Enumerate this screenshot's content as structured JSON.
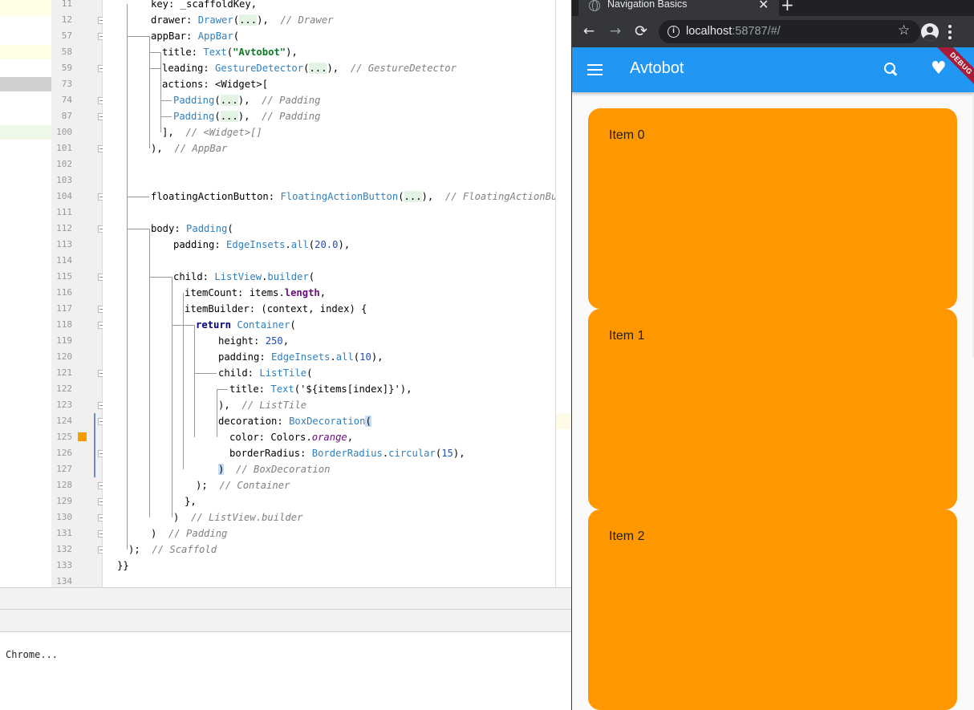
{
  "ide": {
    "lines": [
      {
        "no": "11",
        "tokens": [
          {
            "t": "key: _scaffoldKey,",
            "c": "tk-prop"
          }
        ]
      },
      {
        "no": "12",
        "tokens": [
          {
            "t": "drawer: ",
            "c": "tk-prop"
          },
          {
            "t": "Drawer",
            "c": "tk-cls"
          },
          {
            "t": "(",
            "c": "tk-prop"
          },
          {
            "t": "...",
            "c": "tk-ell"
          },
          {
            "t": "),  ",
            "c": "tk-prop"
          },
          {
            "t": "// Drawer",
            "c": "tk-cmt"
          }
        ]
      },
      {
        "no": "57",
        "tokens": [
          {
            "t": "appBar: ",
            "c": "tk-prop"
          },
          {
            "t": "AppBar",
            "c": "tk-cls"
          },
          {
            "t": "(",
            "c": "tk-prop"
          }
        ]
      },
      {
        "no": "58",
        "tokens": [
          {
            "t": "title: ",
            "c": "tk-prop"
          },
          {
            "t": "Text",
            "c": "tk-cls"
          },
          {
            "t": "(",
            "c": "tk-prop"
          },
          {
            "t": "\"Avtobot\"",
            "c": "tk-str"
          },
          {
            "t": "),",
            "c": "tk-prop"
          }
        ]
      },
      {
        "no": "59",
        "tokens": [
          {
            "t": "leading: ",
            "c": "tk-prop"
          },
          {
            "t": "GestureDetector",
            "c": "tk-cls"
          },
          {
            "t": "(",
            "c": "tk-prop"
          },
          {
            "t": "...",
            "c": "tk-ell"
          },
          {
            "t": "),  ",
            "c": "tk-prop"
          },
          {
            "t": "// GestureDetector",
            "c": "tk-cmt"
          }
        ]
      },
      {
        "no": "73",
        "tokens": [
          {
            "t": "actions: <Widget>[",
            "c": "tk-prop"
          }
        ]
      },
      {
        "no": "74",
        "tokens": [
          {
            "t": "Padding",
            "c": "tk-cls"
          },
          {
            "t": "(",
            "c": "tk-prop"
          },
          {
            "t": "...",
            "c": "tk-ell"
          },
          {
            "t": "),  ",
            "c": "tk-prop"
          },
          {
            "t": "// Padding",
            "c": "tk-cmt"
          }
        ]
      },
      {
        "no": "87",
        "tokens": [
          {
            "t": "Padding",
            "c": "tk-cls"
          },
          {
            "t": "(",
            "c": "tk-prop"
          },
          {
            "t": "...",
            "c": "tk-ell"
          },
          {
            "t": "),  ",
            "c": "tk-prop"
          },
          {
            "t": "// Padding",
            "c": "tk-cmt"
          }
        ]
      },
      {
        "no": "100",
        "tokens": [
          {
            "t": "],  ",
            "c": "tk-prop"
          },
          {
            "t": "// <Widget>[]",
            "c": "tk-cmt"
          }
        ]
      },
      {
        "no": "101",
        "tokens": [
          {
            "t": "),  ",
            "c": "tk-prop"
          },
          {
            "t": "// AppBar",
            "c": "tk-cmt"
          }
        ]
      },
      {
        "no": "102",
        "tokens": []
      },
      {
        "no": "103",
        "tokens": []
      },
      {
        "no": "104",
        "tokens": [
          {
            "t": "floatingActionButton: ",
            "c": "tk-prop"
          },
          {
            "t": "FloatingActionButton",
            "c": "tk-cls"
          },
          {
            "t": "(",
            "c": "tk-prop"
          },
          {
            "t": "...",
            "c": "tk-ell"
          },
          {
            "t": "),  ",
            "c": "tk-prop"
          },
          {
            "t": "// FloatingActionButton",
            "c": "tk-cmt"
          }
        ]
      },
      {
        "no": "111",
        "tokens": []
      },
      {
        "no": "112",
        "tokens": [
          {
            "t": "body: ",
            "c": "tk-prop"
          },
          {
            "t": "Padding",
            "c": "tk-cls"
          },
          {
            "t": "(",
            "c": "tk-prop"
          }
        ]
      },
      {
        "no": "113",
        "tokens": [
          {
            "t": "padding: ",
            "c": "tk-prop"
          },
          {
            "t": "EdgeInsets",
            "c": "tk-cls"
          },
          {
            "t": ".",
            "c": "tk-prop"
          },
          {
            "t": "all",
            "c": "tk-cls"
          },
          {
            "t": "(",
            "c": "tk-prop"
          },
          {
            "t": "20.0",
            "c": "tk-num"
          },
          {
            "t": "),",
            "c": "tk-prop"
          }
        ]
      },
      {
        "no": "114",
        "tokens": []
      },
      {
        "no": "115",
        "tokens": [
          {
            "t": "child: ",
            "c": "tk-prop"
          },
          {
            "t": "ListView",
            "c": "tk-cls"
          },
          {
            "t": ".",
            "c": "tk-prop"
          },
          {
            "t": "builder",
            "c": "tk-cls"
          },
          {
            "t": "(",
            "c": "tk-prop"
          }
        ]
      },
      {
        "no": "116",
        "tokens": [
          {
            "t": "itemCount: items.",
            "c": "tk-prop"
          },
          {
            "t": "length",
            "c": "tk-field"
          },
          {
            "t": ",",
            "c": "tk-prop"
          }
        ]
      },
      {
        "no": "117",
        "tokens": [
          {
            "t": "itemBuilder: (context, index) {",
            "c": "tk-prop"
          }
        ]
      },
      {
        "no": "118",
        "tokens": [
          {
            "t": "return ",
            "c": "tk-kw"
          },
          {
            "t": "Container",
            "c": "tk-cls"
          },
          {
            "t": "(",
            "c": "tk-prop"
          }
        ]
      },
      {
        "no": "119",
        "tokens": [
          {
            "t": "height: ",
            "c": "tk-prop"
          },
          {
            "t": "250",
            "c": "tk-num"
          },
          {
            "t": ",",
            "c": "tk-prop"
          }
        ]
      },
      {
        "no": "120",
        "tokens": [
          {
            "t": "padding: ",
            "c": "tk-prop"
          },
          {
            "t": "EdgeInsets",
            "c": "tk-cls"
          },
          {
            "t": ".",
            "c": "tk-prop"
          },
          {
            "t": "all",
            "c": "tk-cls"
          },
          {
            "t": "(",
            "c": "tk-prop"
          },
          {
            "t": "10",
            "c": "tk-num"
          },
          {
            "t": "),",
            "c": "tk-prop"
          }
        ]
      },
      {
        "no": "121",
        "tokens": [
          {
            "t": "child: ",
            "c": "tk-prop"
          },
          {
            "t": "ListTile",
            "c": "tk-cls"
          },
          {
            "t": "(",
            "c": "tk-prop"
          }
        ]
      },
      {
        "no": "122",
        "tokens": [
          {
            "t": "title: ",
            "c": "tk-prop"
          },
          {
            "t": "Text",
            "c": "tk-cls"
          },
          {
            "t": "('${items[index]}'),",
            "c": "tk-prop"
          }
        ]
      },
      {
        "no": "123",
        "tokens": [
          {
            "t": "),  ",
            "c": "tk-prop"
          },
          {
            "t": "// ListTile",
            "c": "tk-cmt"
          }
        ]
      },
      {
        "no": "124",
        "tokens": [
          {
            "t": "decoration: ",
            "c": "tk-prop"
          },
          {
            "t": "BoxDecoration",
            "c": "tk-cls"
          },
          {
            "t": "(",
            "c": "tk-brace"
          }
        ]
      },
      {
        "no": "125",
        "tokens": [
          {
            "t": "color: Colors.",
            "c": "tk-prop"
          },
          {
            "t": "orange",
            "c": "tk-cst"
          },
          {
            "t": ",",
            "c": "tk-prop"
          }
        ]
      },
      {
        "no": "126",
        "tokens": [
          {
            "t": "borderRadius: ",
            "c": "tk-prop"
          },
          {
            "t": "BorderRadius",
            "c": "tk-cls"
          },
          {
            "t": ".",
            "c": "tk-prop"
          },
          {
            "t": "circular",
            "c": "tk-cls"
          },
          {
            "t": "(",
            "c": "tk-prop"
          },
          {
            "t": "15",
            "c": "tk-num"
          },
          {
            "t": "),",
            "c": "tk-prop"
          }
        ]
      },
      {
        "no": "127",
        "tokens": [
          {
            "t": ")",
            "c": "tk-brace"
          },
          {
            "t": "  ",
            "c": "tk-prop"
          },
          {
            "t": "// BoxDecoration",
            "c": "tk-cmt"
          }
        ]
      },
      {
        "no": "128",
        "tokens": [
          {
            "t": ");  ",
            "c": "tk-prop"
          },
          {
            "t": "// Container",
            "c": "tk-cmt"
          }
        ]
      },
      {
        "no": "129",
        "tokens": [
          {
            "t": "},",
            "c": "tk-prop"
          }
        ]
      },
      {
        "no": "130",
        "tokens": [
          {
            "t": ")  ",
            "c": "tk-prop"
          },
          {
            "t": "// ListView.builder",
            "c": "tk-cmt"
          }
        ]
      },
      {
        "no": "131",
        "tokens": [
          {
            "t": ")  ",
            "c": "tk-prop"
          },
          {
            "t": "// Padding",
            "c": "tk-cmt"
          }
        ]
      },
      {
        "no": "132",
        "tokens": [
          {
            "t": ");  ",
            "c": "tk-prop"
          },
          {
            "t": "// Scaffold",
            "c": "tk-cmt"
          }
        ]
      },
      {
        "no": "133",
        "tokens": [
          {
            "t": "}}",
            "c": "tk-prop"
          }
        ]
      },
      {
        "no": "134",
        "tokens": []
      }
    ],
    "console_text": "Chrome..."
  },
  "browser": {
    "tab_title": "Navigation Basics",
    "tab_close": "✕",
    "new_tab": "+",
    "back": "←",
    "forward": "→",
    "reload": "⟳",
    "url_host": "localhost",
    "url_rest": ":58787/#/",
    "info": "i",
    "star": "☆",
    "colors": {
      "dark": "#202124",
      "toolbar": "#35363a"
    }
  },
  "app": {
    "title": "Avtobot",
    "debug_label": "DEBUG",
    "heart": "♥",
    "colors": {
      "appbar": "#2196f3",
      "card": "#ff9800"
    },
    "items": [
      "Item 0",
      "Item 1",
      "Item 2"
    ]
  }
}
